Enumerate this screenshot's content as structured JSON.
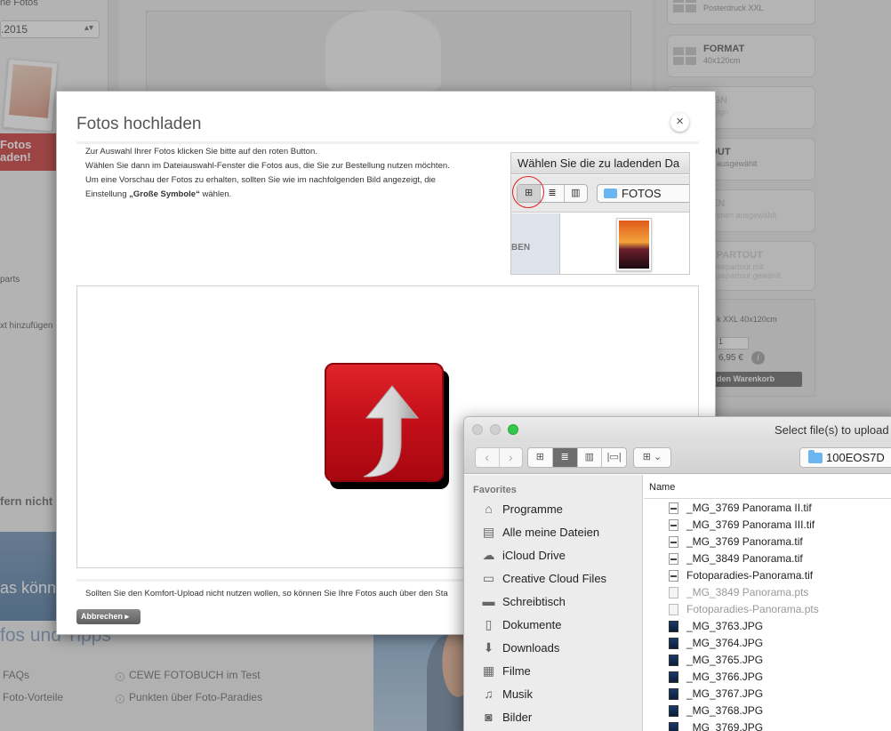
{
  "background": {
    "left_label_top": "ne Fotos",
    "date_select_value": ".2015",
    "promo_line1": "Fotos",
    "promo_line2": "aden!",
    "left_link_parts": "parts",
    "left_link_text": "xt hinzufügen",
    "left_text_fern": "fern nicht a",
    "banner_text": "as könnt",
    "tipps_heading": "fos und Tipps",
    "links": [
      "FAQs",
      "CEWE FOTOBUCH im Test",
      "Foto-Vorteile",
      "Punkten über Foto-Paradies"
    ],
    "cards": [
      {
        "title": "",
        "subtitle": "Posterdruck XXL",
        "faint": false
      },
      {
        "title": "FORMAT",
        "subtitle": "40x120cm",
        "faint": false
      },
      {
        "title": "SIGN",
        "subtitle": "Design",
        "faint": true
      },
      {
        "title": "YOUT",
        "subtitle": "out ausgewählt",
        "faint": false
      },
      {
        "title": "MEN",
        "subtitle": "Rahmen ausgewählt",
        "faint": true
      },
      {
        "title": "SEPARTOUT",
        "subtitle": "Passepartout mit\nPassepartout gewählt",
        "faint": true
      }
    ],
    "order_summary": "k XXL 40x120cm",
    "order_qty": "1",
    "order_price": "6,95 €",
    "cart_button": "den Warenkorb"
  },
  "dialog": {
    "title": "Fotos hochladen",
    "close_glyph": "×",
    "instructions": [
      "Zur Auswahl Ihrer Fotos klicken Sie bitte auf den roten Button.",
      "Wählen Sie dann im Dateiauswahl-Fenster die Fotos aus, die Sie zur Bestellung nutzen möchten.",
      "Um eine Vorschau der Fotos zu erhalten, sollten Sie wie im nachfolgenden Bild angezeigt, die"
    ],
    "instruction_last_prefix": "Einstellung ",
    "instruction_last_bold": "„Große Symbole“",
    "instruction_last_suffix": " wählen.",
    "preview": {
      "header": "Wählen Sie die zu ladenden Da",
      "folder": "FOTOS",
      "sidebar_label": "BEN"
    },
    "bottom_text": "Sollten Sie den Komfort-Upload nicht nutzen wollen, so können Sie Ihre Fotos auch über den Sta",
    "cancel_label": "Abbrechen ▸"
  },
  "picker": {
    "window_title": "Select file(s) to upload",
    "path_folder": "100EOS7D",
    "column_name": "Name",
    "sidebar_heading": "Favorites",
    "favorites": [
      {
        "icon": "apps-icon",
        "glyph": "⌂",
        "label": "Programme"
      },
      {
        "icon": "all-files-icon",
        "glyph": "▤",
        "label": "Alle meine Dateien"
      },
      {
        "icon": "cloud-icon",
        "glyph": "☁",
        "label": "iCloud Drive"
      },
      {
        "icon": "folder-icon",
        "glyph": "▭",
        "label": "Creative Cloud Files"
      },
      {
        "icon": "desktop-icon",
        "glyph": "▬",
        "label": "Schreibtisch"
      },
      {
        "icon": "documents-icon",
        "glyph": "▯",
        "label": "Dokumente"
      },
      {
        "icon": "downloads-icon",
        "glyph": "⬇",
        "label": "Downloads"
      },
      {
        "icon": "movies-icon",
        "glyph": "▦",
        "label": "Filme"
      },
      {
        "icon": "music-icon",
        "glyph": "♫",
        "label": "Musik"
      },
      {
        "icon": "pictures-icon",
        "glyph": "◙",
        "label": "Bilder"
      }
    ],
    "files": [
      {
        "name": "_MG_3769 Panorama II.tif",
        "kind": "doc",
        "dim": false
      },
      {
        "name": "_MG_3769 Panorama III.tif",
        "kind": "doc",
        "dim": false
      },
      {
        "name": "_MG_3769 Panorama.tif",
        "kind": "doc",
        "dim": false
      },
      {
        "name": "_MG_3849 Panorama.tif",
        "kind": "doc",
        "dim": false
      },
      {
        "name": "Fotoparadies-Panorama.tif",
        "kind": "doc",
        "dim": false
      },
      {
        "name": "_MG_3849 Panorama.pts",
        "kind": "dim",
        "dim": true
      },
      {
        "name": "Fotoparadies-Panorama.pts",
        "kind": "dim",
        "dim": true
      },
      {
        "name": "_MG_3763.JPG",
        "kind": "img",
        "dim": false
      },
      {
        "name": "_MG_3764.JPG",
        "kind": "img",
        "dim": false
      },
      {
        "name": "_MG_3765.JPG",
        "kind": "img",
        "dim": false
      },
      {
        "name": "_MG_3766.JPG",
        "kind": "img",
        "dim": false
      },
      {
        "name": "_MG_3767.JPG",
        "kind": "img",
        "dim": false
      },
      {
        "name": "_MG_3768.JPG",
        "kind": "img",
        "dim": false
      },
      {
        "name": "_MG_3769.JPG",
        "kind": "img",
        "dim": false
      }
    ]
  },
  "colors": {
    "upload_red": "#c5101a",
    "close_button_green": "#34c84a",
    "folder_blue": "#6bb6f0",
    "annotation_red": "#e02020"
  }
}
